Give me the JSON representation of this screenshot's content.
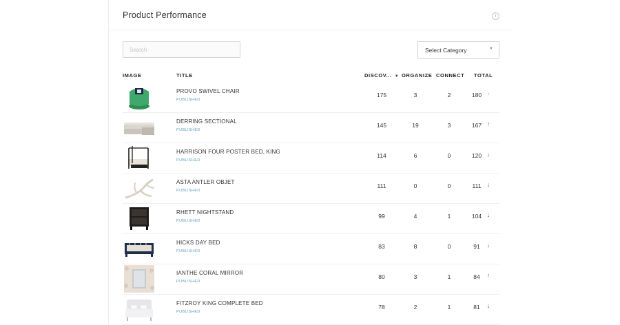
{
  "panel": {
    "title": "Product Performance",
    "info_icon": "info-icon",
    "search_placeholder": "Search",
    "category_select": "Select Category"
  },
  "columns": {
    "image": "IMAGE",
    "title": "TITLE",
    "discover": "DISCOV...",
    "organize": "ORGANIZE",
    "connect": "CONNECT",
    "total": "TOTAL"
  },
  "colors": {
    "trend_up": "#1f7a2c",
    "trend_down": "#d32b2b",
    "status_text": "#5a9bb8"
  },
  "rows": [
    {
      "name": "PROVO SWIVEL CHAIR",
      "status": "PUBLISHED",
      "discover": "175",
      "organize": "3",
      "connect": "2",
      "total": "180",
      "trend": "-",
      "trend_type": "flat",
      "image": "green-swivel-chair"
    },
    {
      "name": "DERRING SECTIONAL",
      "status": "PUBLISHED",
      "discover": "145",
      "organize": "19",
      "connect": "3",
      "total": "167",
      "trend": "↑",
      "trend_type": "up",
      "image": "grey-sectional-sofa"
    },
    {
      "name": "HARRISON FOUR POSTER BED, KING",
      "status": "PUBLISHED",
      "discover": "114",
      "organize": "6",
      "connect": "0",
      "total": "120",
      "trend": "↓",
      "trend_type": "down",
      "image": "four-poster-bed"
    },
    {
      "name": "ASTA ANTLER OBJET",
      "status": "PUBLISHED",
      "discover": "111",
      "organize": "0",
      "connect": "0",
      "total": "111",
      "trend": "↓",
      "trend_type": "down",
      "image": "antler-object"
    },
    {
      "name": "RHETT NIGHTSTAND",
      "status": "PUBLISHED",
      "discover": "99",
      "organize": "4",
      "connect": "1",
      "total": "104",
      "trend": "↓",
      "trend_type": "down",
      "image": "dark-nightstand"
    },
    {
      "name": "HICKS DAY BED",
      "status": "PUBLISHED",
      "discover": "83",
      "organize": "8",
      "connect": "0",
      "total": "91",
      "trend": "↓",
      "trend_type": "down",
      "image": "day-bed"
    },
    {
      "name": "IANTHE CORAL MIRROR",
      "status": "PUBLISHED",
      "discover": "80",
      "organize": "3",
      "connect": "1",
      "total": "84",
      "trend": "↑",
      "trend_type": "up",
      "image": "coral-mirror"
    },
    {
      "name": "FITZROY KING COMPLETE BED",
      "status": "PUBLISHED",
      "discover": "78",
      "organize": "2",
      "connect": "1",
      "total": "81",
      "trend": "↓",
      "trend_type": "down",
      "image": "white-king-bed"
    }
  ]
}
